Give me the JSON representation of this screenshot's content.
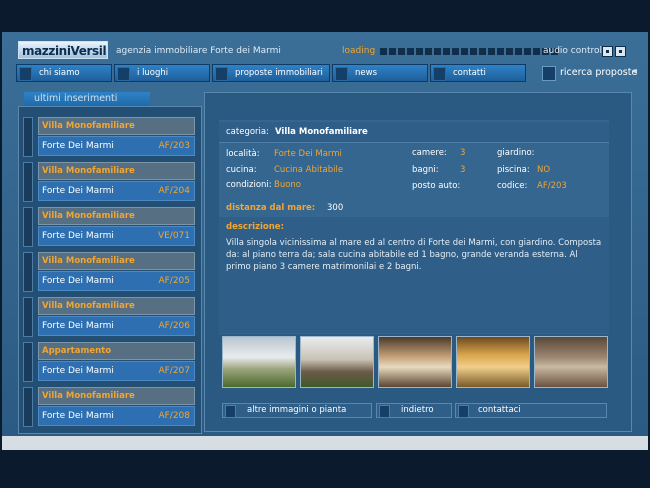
{
  "header": {
    "logo_text": "mazziniVersilia",
    "tagline": "agenzia immobiliare Forte dei Marmi",
    "loading_label": "loading",
    "audio_label": "audio control"
  },
  "nav": {
    "items": [
      "chi siamo",
      "i luoghi",
      "proposte immobiliari",
      "news",
      "contatti"
    ],
    "search_label": "ricerca proposte"
  },
  "sidebar": {
    "title": "ultimi inserimenti",
    "items": [
      {
        "type": "Villa Monofamiliare",
        "location": "Forte Dei Marmi",
        "code": "AF/203"
      },
      {
        "type": "Villa Monofamiliare",
        "location": "Forte Dei Marmi",
        "code": "AF/204"
      },
      {
        "type": "Villa Monofamiliare",
        "location": "Forte Dei Marmi",
        "code": "VE/071"
      },
      {
        "type": "Villa Monofamiliare",
        "location": "Forte Dei Marmi",
        "code": "AF/205"
      },
      {
        "type": "Villa Monofamiliare",
        "location": "Forte Dei Marmi",
        "code": "AF/206"
      },
      {
        "type": "Appartamento",
        "location": "Forte Dei Marmi",
        "code": "AF/207"
      },
      {
        "type": "Villa Monofamiliare",
        "location": "Forte Dei Marmi",
        "code": "AF/208"
      }
    ]
  },
  "detail": {
    "categoria_label": "categoria:",
    "categoria_value": "Villa Monofamiliare",
    "localita_label": "località:",
    "localita_value": "Forte Dei Marmi",
    "cucina_label": "cucina:",
    "cucina_value": "Cucina Abitabile",
    "condizioni_label": "condizioni:",
    "condizioni_value": "Buono",
    "camere_label": "camere:",
    "camere_value": "3",
    "bagni_label": "bagni:",
    "bagni_value": "3",
    "posto_auto_label": "posto auto:",
    "giardino_label": "giardino:",
    "piscina_label": "piscina:",
    "piscina_value": "NO",
    "codice_label": "codice:",
    "codice_value": "AF/203",
    "distanza_label": "distanza dal mare:",
    "distanza_value": "300",
    "descrizione_label": "descrizione:",
    "descrizione_text": "Villa singola vicinissima al mare ed al centro di Forte dei Marmi, con giardino. Composta da: al piano terra da; sala cucina abitabile ed 1 bagno, grande veranda esterna. Al primo piano 3 camere matrimonilai e 2 bagni."
  },
  "actions": {
    "more_images": "altre immagini o pianta",
    "back": "indietro",
    "contact": "contattaci"
  }
}
